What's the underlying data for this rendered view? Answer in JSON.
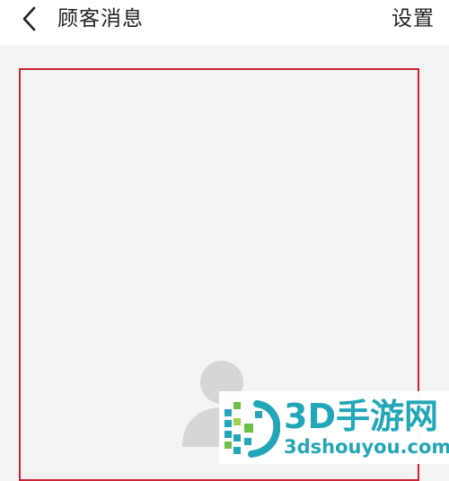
{
  "header": {
    "title": "顾客消息",
    "settings_label": "设置"
  },
  "watermark": {
    "name": "3D手游网",
    "url": "3dshouyou.com"
  },
  "colors": {
    "highlight_border": "#cc2233",
    "watermark_accent": "#23a7b8",
    "avatar_placeholder": "#d6d6d6"
  },
  "icons": {
    "back": "chevron-left-icon",
    "avatar": "person-placeholder-icon"
  }
}
